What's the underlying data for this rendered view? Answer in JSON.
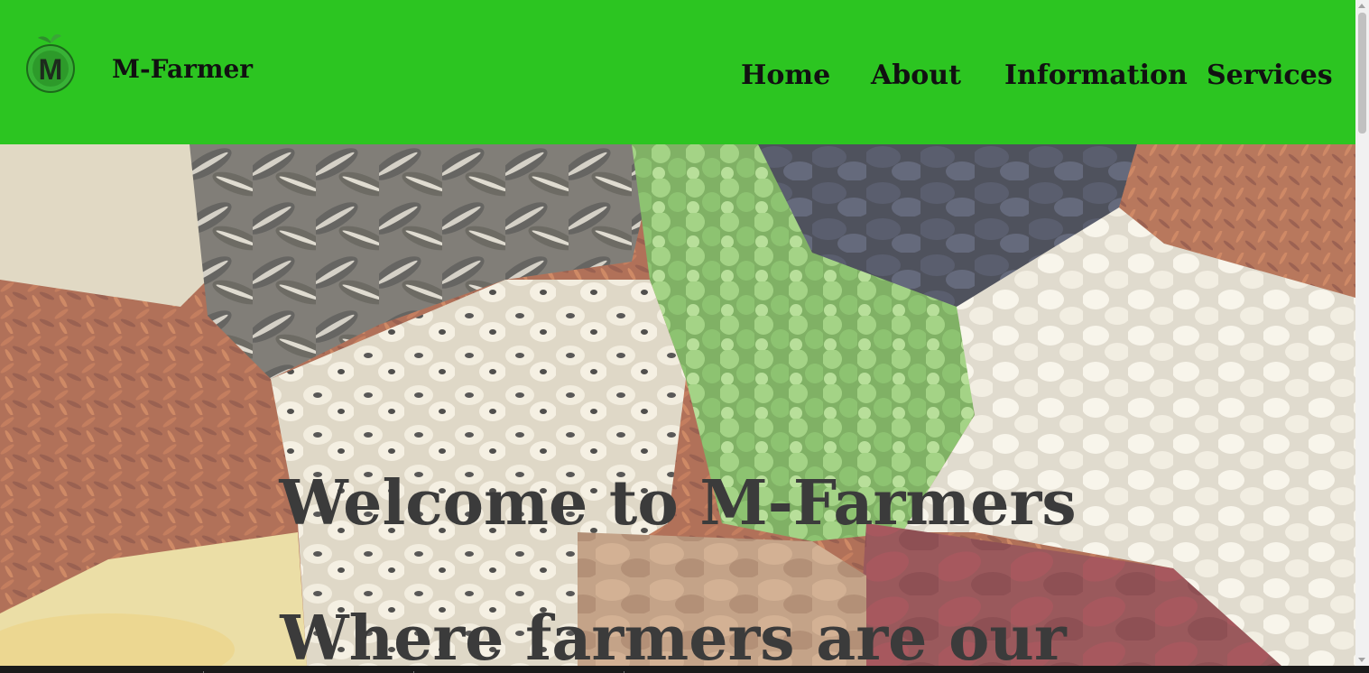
{
  "header": {
    "brand": "M-Farmer",
    "logo_letter": "M",
    "background_color": "#2cc521",
    "nav": [
      {
        "label": "Home"
      },
      {
        "label": "About"
      },
      {
        "label": "Information"
      },
      {
        "label": "Services"
      }
    ]
  },
  "hero": {
    "title": "Welcome to M-Farmers",
    "subtitle": "Where farmers are our",
    "background_image": "assorted beans, seeds, and grains"
  }
}
